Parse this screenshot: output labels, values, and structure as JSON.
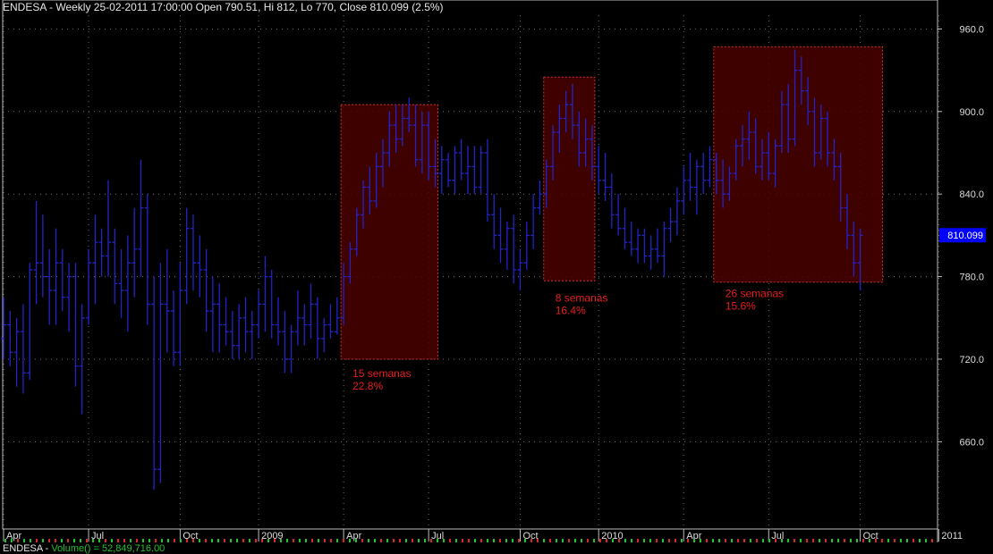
{
  "header": {
    "title": "ENDESA - Weekly 25-02-2011 17:00:00 Open 790.51, Hi 812, Lo 770, Close 810.099 (2.5%)"
  },
  "footer": {
    "symbol": "ENDESA - ",
    "volume_label": "Volume() = 52,849,716.00"
  },
  "colors": {
    "background": "#000000",
    "bars": "#2323c8",
    "zone_fill": "#4a0000",
    "zone_border": "#d23232",
    "annotation": "#e61e1e",
    "grid": "#6e6e6e",
    "axis_text": "#dcdcdc",
    "price_badge": "#0000ff"
  },
  "chart_data": {
    "type": "ohlc_bar",
    "ylim": [
      610,
      970
    ],
    "y_ticks": [
      660.0,
      720.0,
      780.0,
      840.0,
      900.0,
      960.0
    ],
    "y_tick_labels": [
      "660.0",
      "720.0",
      "780.0",
      "840.0",
      "900.0",
      "960.0"
    ],
    "last_price": 810.099,
    "last_price_label": "810.099",
    "x_ticks": [
      {
        "label": "Apr",
        "week": 0
      },
      {
        "label": "Jul",
        "week": 13
      },
      {
        "label": "Oct",
        "week": 27
      },
      {
        "label": "2009",
        "week": 39
      },
      {
        "label": "Apr",
        "week": 52
      },
      {
        "label": "Jul",
        "week": 65
      },
      {
        "label": "Oct",
        "week": 79
      },
      {
        "label": "2010",
        "week": 91
      },
      {
        "label": "Apr",
        "week": 104
      },
      {
        "label": "Jul",
        "week": 117
      },
      {
        "label": "Oct",
        "week": 131
      },
      {
        "label": "2011",
        "week": 143
      }
    ],
    "bars": [
      [
        0,
        735,
        765,
        720,
        745
      ],
      [
        1,
        745,
        755,
        715,
        725
      ],
      [
        2,
        725,
        750,
        700,
        740
      ],
      [
        3,
        740,
        760,
        695,
        710
      ],
      [
        4,
        710,
        790,
        705,
        785
      ],
      [
        5,
        785,
        835,
        760,
        790
      ],
      [
        6,
        790,
        825,
        765,
        780
      ],
      [
        7,
        780,
        800,
        745,
        770
      ],
      [
        8,
        770,
        815,
        745,
        790
      ],
      [
        9,
        790,
        800,
        755,
        765
      ],
      [
        10,
        765,
        790,
        740,
        780
      ],
      [
        11,
        780,
        790,
        700,
        715
      ],
      [
        12,
        715,
        760,
        680,
        750
      ],
      [
        13,
        750,
        800,
        745,
        790
      ],
      [
        14,
        790,
        825,
        760,
        805
      ],
      [
        15,
        805,
        815,
        780,
        795
      ],
      [
        16,
        795,
        850,
        780,
        805
      ],
      [
        17,
        805,
        815,
        760,
        775
      ],
      [
        18,
        775,
        800,
        750,
        770
      ],
      [
        19,
        770,
        810,
        740,
        790
      ],
      [
        20,
        790,
        830,
        765,
        800
      ],
      [
        21,
        800,
        865,
        780,
        830
      ],
      [
        22,
        830,
        840,
        745,
        760
      ],
      [
        23,
        760,
        780,
        625,
        640
      ],
      [
        24,
        640,
        790,
        630,
        760
      ],
      [
        25,
        760,
        800,
        725,
        755
      ],
      [
        26,
        755,
        770,
        715,
        725
      ],
      [
        27,
        725,
        790,
        715,
        770
      ],
      [
        28,
        770,
        830,
        760,
        815
      ],
      [
        29,
        815,
        825,
        770,
        790
      ],
      [
        30,
        790,
        810,
        765,
        785
      ],
      [
        31,
        785,
        800,
        740,
        755
      ],
      [
        32,
        755,
        780,
        725,
        760
      ],
      [
        33,
        760,
        775,
        725,
        745
      ],
      [
        34,
        745,
        765,
        730,
        740
      ],
      [
        35,
        740,
        755,
        720,
        730
      ],
      [
        36,
        730,
        760,
        720,
        750
      ],
      [
        37,
        750,
        765,
        725,
        740
      ],
      [
        38,
        740,
        755,
        720,
        745
      ],
      [
        39,
        745,
        770,
        735,
        760
      ],
      [
        40,
        760,
        795,
        740,
        780
      ],
      [
        41,
        780,
        785,
        735,
        745
      ],
      [
        42,
        745,
        765,
        730,
        740
      ],
      [
        43,
        740,
        755,
        710,
        720
      ],
      [
        44,
        720,
        745,
        710,
        740
      ],
      [
        45,
        740,
        770,
        730,
        750
      ],
      [
        46,
        750,
        760,
        730,
        745
      ],
      [
        47,
        745,
        775,
        735,
        760
      ],
      [
        48,
        760,
        765,
        720,
        735
      ],
      [
        49,
        735,
        750,
        725,
        745
      ],
      [
        50,
        745,
        760,
        735,
        740
      ],
      [
        51,
        740,
        765,
        738,
        750
      ],
      [
        52,
        750,
        790,
        745,
        780
      ],
      [
        53,
        780,
        805,
        775,
        800
      ],
      [
        54,
        800,
        830,
        795,
        825
      ],
      [
        55,
        825,
        850,
        815,
        845
      ],
      [
        56,
        845,
        860,
        825,
        835
      ],
      [
        57,
        835,
        870,
        830,
        860
      ],
      [
        58,
        860,
        880,
        845,
        870
      ],
      [
        59,
        870,
        900,
        860,
        890
      ],
      [
        60,
        890,
        905,
        870,
        880
      ],
      [
        61,
        880,
        905,
        875,
        895
      ],
      [
        62,
        895,
        910,
        885,
        890
      ],
      [
        63,
        890,
        905,
        860,
        865
      ],
      [
        64,
        865,
        900,
        855,
        890
      ],
      [
        65,
        890,
        900,
        850,
        860
      ],
      [
        66,
        860,
        880,
        845,
        855
      ],
      [
        67,
        855,
        875,
        840,
        865
      ],
      [
        68,
        865,
        870,
        845,
        850
      ],
      [
        69,
        850,
        875,
        840,
        870
      ],
      [
        70,
        870,
        880,
        850,
        855
      ],
      [
        71,
        855,
        875,
        840,
        860
      ],
      [
        72,
        860,
        875,
        840,
        845
      ],
      [
        73,
        845,
        875,
        840,
        870
      ],
      [
        74,
        870,
        880,
        820,
        825
      ],
      [
        75,
        825,
        840,
        800,
        810
      ],
      [
        76,
        810,
        830,
        790,
        800
      ],
      [
        77,
        800,
        820,
        785,
        815
      ],
      [
        78,
        815,
        825,
        775,
        785
      ],
      [
        79,
        785,
        800,
        770,
        790
      ],
      [
        80,
        790,
        820,
        785,
        810
      ],
      [
        81,
        810,
        840,
        800,
        830
      ],
      [
        82,
        830,
        850,
        825,
        840
      ],
      [
        83,
        840,
        865,
        830,
        860
      ],
      [
        84,
        860,
        890,
        850,
        885
      ],
      [
        85,
        885,
        905,
        870,
        895
      ],
      [
        86,
        895,
        915,
        885,
        905
      ],
      [
        87,
        905,
        920,
        880,
        890
      ],
      [
        88,
        890,
        900,
        860,
        870
      ],
      [
        89,
        870,
        895,
        860,
        880
      ],
      [
        90,
        880,
        890,
        850,
        860
      ],
      [
        91,
        860,
        875,
        840,
        850
      ],
      [
        92,
        850,
        870,
        835,
        845
      ],
      [
        93,
        845,
        855,
        815,
        825
      ],
      [
        94,
        825,
        840,
        810,
        815
      ],
      [
        95,
        815,
        830,
        800,
        805
      ],
      [
        96,
        805,
        820,
        795,
        800
      ],
      [
        97,
        800,
        815,
        790,
        810
      ],
      [
        98,
        810,
        815,
        790,
        795
      ],
      [
        99,
        795,
        810,
        785,
        800
      ],
      [
        100,
        800,
        815,
        790,
        795
      ],
      [
        101,
        795,
        820,
        780,
        815
      ],
      [
        102,
        815,
        830,
        805,
        820
      ],
      [
        103,
        820,
        845,
        810,
        835
      ],
      [
        104,
        835,
        860,
        825,
        850
      ],
      [
        105,
        850,
        870,
        835,
        845
      ],
      [
        106,
        845,
        865,
        825,
        860
      ],
      [
        107,
        860,
        870,
        840,
        850
      ],
      [
        108,
        850,
        875,
        845,
        865
      ],
      [
        109,
        865,
        870,
        840,
        850
      ],
      [
        110,
        850,
        865,
        830,
        840
      ],
      [
        111,
        840,
        860,
        835,
        855
      ],
      [
        112,
        855,
        880,
        850,
        875
      ],
      [
        113,
        875,
        890,
        860,
        880
      ],
      [
        114,
        880,
        900,
        865,
        885
      ],
      [
        115,
        885,
        895,
        855,
        860
      ],
      [
        116,
        860,
        880,
        850,
        870
      ],
      [
        117,
        870,
        885,
        850,
        855
      ],
      [
        118,
        855,
        880,
        845,
        875
      ],
      [
        119,
        875,
        915,
        870,
        905
      ],
      [
        120,
        905,
        920,
        870,
        880
      ],
      [
        121,
        880,
        945,
        875,
        930
      ],
      [
        122,
        930,
        940,
        905,
        915
      ],
      [
        123,
        915,
        925,
        890,
        900
      ],
      [
        124,
        900,
        910,
        860,
        870
      ],
      [
        125,
        870,
        905,
        865,
        895
      ],
      [
        126,
        895,
        900,
        860,
        870
      ],
      [
        127,
        870,
        880,
        850,
        860
      ],
      [
        128,
        860,
        870,
        820,
        830
      ],
      [
        129,
        830,
        840,
        800,
        810
      ],
      [
        130,
        810,
        820,
        780,
        790
      ],
      [
        131,
        790,
        815,
        770,
        810
      ]
    ],
    "zones": [
      {
        "start_week": 52,
        "end_week": 66,
        "low": 720,
        "high": 905,
        "label_line1": "15 semanas",
        "label_line2": "22.8%",
        "label_price": 707
      },
      {
        "start_week": 83,
        "end_week": 90,
        "low": 777,
        "high": 925,
        "label_line1": "8 semanas",
        "label_line2": "16.4%",
        "label_price": 762
      },
      {
        "start_week": 109,
        "end_week": 134,
        "low": 776,
        "high": 947,
        "label_line1": "26 semanas",
        "label_line2": "15.6%",
        "label_price": 765
      }
    ]
  }
}
